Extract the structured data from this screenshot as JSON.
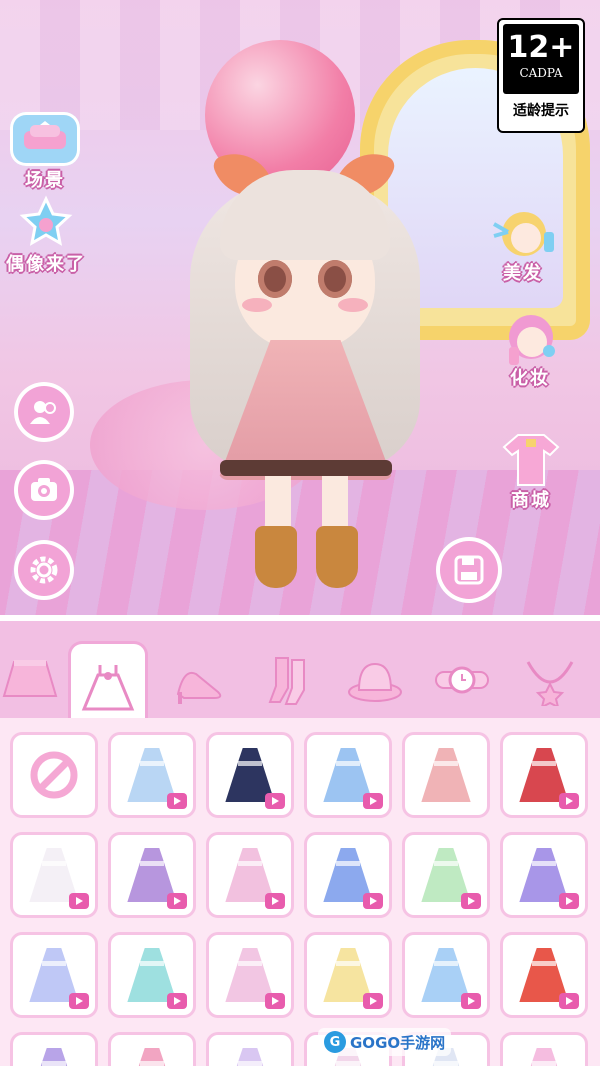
{
  "age_rating": {
    "number": "12+",
    "org": "CADPA",
    "tip": "适龄提示"
  },
  "left_menu": {
    "scene_label": "场景",
    "idol_label": "偶像来了"
  },
  "right_menu": {
    "hair_label": "美发",
    "makeup_label": "化妆",
    "shop_label": "商城"
  },
  "circle_buttons": [
    "friends-icon",
    "camera-icon",
    "settings-icon"
  ],
  "tabs": [
    "skirt",
    "dress",
    "shoes",
    "socks",
    "hat",
    "watch",
    "necklace"
  ],
  "active_tab": "dress",
  "grid": {
    "rows": [
      [
        {
          "type": "none"
        },
        {
          "color": "#b9d6f4",
          "video": true
        },
        {
          "color": "#2d3560",
          "video": true
        },
        {
          "color": "#9cc4f2",
          "video": true
        },
        {
          "color": "#f0b3b6",
          "video": false
        },
        {
          "color": "#d8474f",
          "video": true
        }
      ],
      [
        {
          "color": "#f4f0f6",
          "video": true
        },
        {
          "color": "#b796de",
          "video": true
        },
        {
          "color": "#f2c1df",
          "video": true
        },
        {
          "color": "#8ca9ee",
          "video": true
        },
        {
          "color": "#bfeac2",
          "video": true
        },
        {
          "color": "#a896e8",
          "video": true
        }
      ],
      [
        {
          "color": "#bfc8f6",
          "video": true
        },
        {
          "color": "#9ee0e0",
          "video": true
        },
        {
          "color": "#f2c6e3",
          "video": true
        },
        {
          "color": "#f6e4a0",
          "video": true
        },
        {
          "color": "#a9d0f6",
          "video": true
        },
        {
          "color": "#e8574a",
          "video": true
        }
      ],
      [
        {
          "color": "#b8a4e8",
          "video": false
        },
        {
          "color": "#f2a5c2",
          "video": false
        },
        {
          "color": "#d9c7f2",
          "video": false
        },
        {
          "color": "#f2d6ea",
          "video": false
        },
        {
          "color": "#e0e6f4",
          "video": false
        },
        {
          "color": "#f5bde0",
          "video": false
        }
      ]
    ]
  },
  "watermark": {
    "text": "GOGO手游网"
  }
}
